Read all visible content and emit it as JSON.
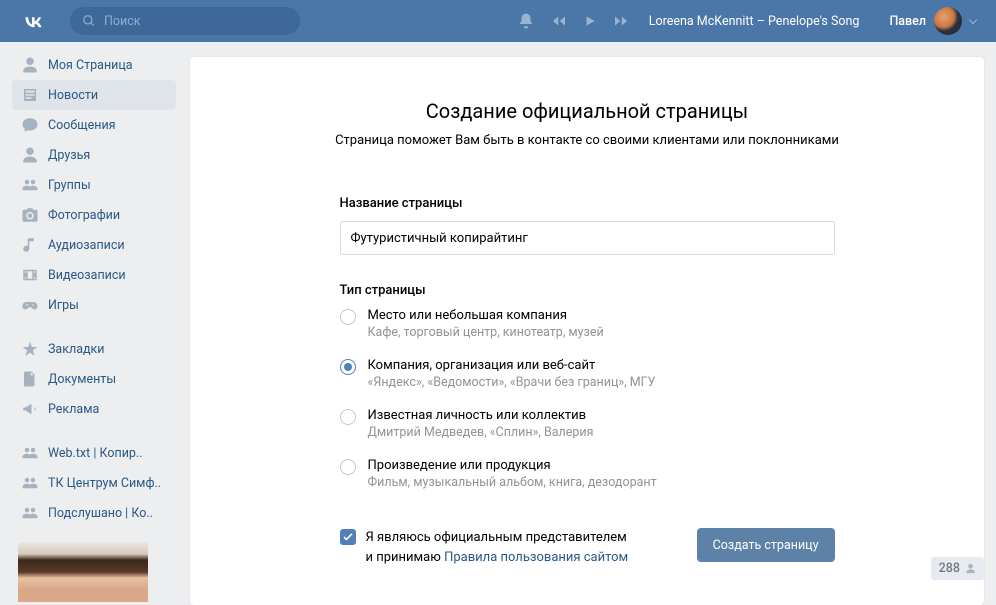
{
  "header": {
    "search_placeholder": "Поиск",
    "now_playing": "Loreena McKennitt – Penelope's Song",
    "user_name": "Павел"
  },
  "sidebar": {
    "items": [
      {
        "icon": "profile",
        "label": "Моя Страница"
      },
      {
        "icon": "news",
        "label": "Новости"
      },
      {
        "icon": "messages",
        "label": "Сообщения"
      },
      {
        "icon": "friends",
        "label": "Друзья"
      },
      {
        "icon": "groups",
        "label": "Группы"
      },
      {
        "icon": "photos",
        "label": "Фотографии"
      },
      {
        "icon": "audio",
        "label": "Аудиозаписи"
      },
      {
        "icon": "video",
        "label": "Видеозаписи"
      },
      {
        "icon": "games",
        "label": "Игры"
      }
    ],
    "items2": [
      {
        "icon": "bookmark",
        "label": "Закладки"
      },
      {
        "icon": "docs",
        "label": "Документы"
      },
      {
        "icon": "ads",
        "label": "Реклама"
      }
    ],
    "items3": [
      {
        "icon": "group",
        "label": "Web.txt | Копир.."
      },
      {
        "icon": "group",
        "label": "ТК Центрум Симф.."
      },
      {
        "icon": "group",
        "label": "Подслушано | Ко.."
      }
    ]
  },
  "page": {
    "title": "Создание официальной страницы",
    "subtitle": "Страница поможет Вам быть в контакте со своими клиентами или поклонниками",
    "name_label": "Название страницы",
    "name_value": "Футуристичный копирайтинг",
    "type_label": "Тип страницы",
    "types": [
      {
        "title": "Место или небольшая компания",
        "hint": "Кафе, торговый центр, кинотеатр, музей",
        "selected": false
      },
      {
        "title": "Компания, организация или веб-сайт",
        "hint": "«Яндекс», «Ведомости», «Врачи без границ», МГУ",
        "selected": true
      },
      {
        "title": "Известная личность или коллектив",
        "hint": "Дмитрий Медведев, «Сплин», Валерия",
        "selected": false
      },
      {
        "title": "Произведение или продукция",
        "hint": "Фильм, музыкальный альбом, книга, дезодорант",
        "selected": false
      }
    ],
    "agree_text_1": "Я являюсь официальным представителем",
    "agree_text_2": "и принимаю ",
    "agree_link": "Правила пользования сайтом",
    "create_btn": "Создать страницу"
  },
  "counter": "288"
}
